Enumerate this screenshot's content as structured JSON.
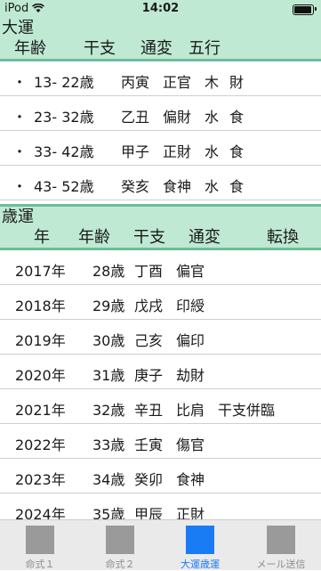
{
  "status_bar": {
    "carrier": "iPod",
    "time": "14:02"
  },
  "taiun": {
    "title": "大運",
    "headers": {
      "age": "年齢",
      "kanshi": "干支",
      "tsuhen": "通変",
      "gogyo": "五行"
    },
    "rows": [
      {
        "bullet": "・",
        "range": "13- 22歳",
        "kanshi": "丙寅",
        "tsuhen": "正官",
        "gogyo": "木",
        "extra": "財"
      },
      {
        "bullet": "・",
        "range": "23- 32歳",
        "kanshi": "乙丑",
        "tsuhen": "偏財",
        "gogyo": "水",
        "extra": "食"
      },
      {
        "bullet": "・",
        "range": "33- 42歳",
        "kanshi": "甲子",
        "tsuhen": "正財",
        "gogyo": "水",
        "extra": "食"
      },
      {
        "bullet": "・",
        "range": "43- 52歳",
        "kanshi": "癸亥",
        "tsuhen": "食神",
        "gogyo": "水",
        "extra": "食"
      }
    ]
  },
  "saiun": {
    "title": "歳運",
    "headers": {
      "year": "年",
      "age": "年齢",
      "kanshi": "干支",
      "tsuhen": "通変",
      "tenkan": "転換"
    },
    "rows": [
      {
        "year": "2017年",
        "age": "28歳",
        "kanshi": "丁酉",
        "tsuhen": "偏官",
        "tenkan": ""
      },
      {
        "year": "2018年",
        "age": "29歳",
        "kanshi": "戊戌",
        "tsuhen": "印綬",
        "tenkan": ""
      },
      {
        "year": "2019年",
        "age": "30歳",
        "kanshi": "己亥",
        "tsuhen": "偏印",
        "tenkan": ""
      },
      {
        "year": "2020年",
        "age": "31歳",
        "kanshi": "庚子",
        "tsuhen": "劫財",
        "tenkan": ""
      },
      {
        "year": "2021年",
        "age": "32歳",
        "kanshi": "辛丑",
        "tsuhen": "比肩",
        "tenkan": "干支併臨"
      },
      {
        "year": "2022年",
        "age": "33歳",
        "kanshi": "壬寅",
        "tsuhen": "傷官",
        "tenkan": ""
      },
      {
        "year": "2023年",
        "age": "34歳",
        "kanshi": "癸卯",
        "tsuhen": "食神",
        "tenkan": ""
      },
      {
        "year": "2024年",
        "age": "35歳",
        "kanshi": "甲辰",
        "tsuhen": "正財",
        "tenkan": ""
      }
    ]
  },
  "tabs": [
    {
      "label": "命式１",
      "icon": "placeholder-square-icon",
      "active": false
    },
    {
      "label": "命式２",
      "icon": "placeholder-square-icon",
      "active": false
    },
    {
      "label": "大運歳運",
      "icon": "placeholder-square-icon",
      "active": true
    },
    {
      "label": "メール送信",
      "icon": "placeholder-square-icon",
      "active": false
    }
  ],
  "colors": {
    "header_bg": "#bfe9d2",
    "separator": "#6dbd9a",
    "tab_active": "#1a7cf5",
    "tab_inactive": "#9a9a9a"
  }
}
